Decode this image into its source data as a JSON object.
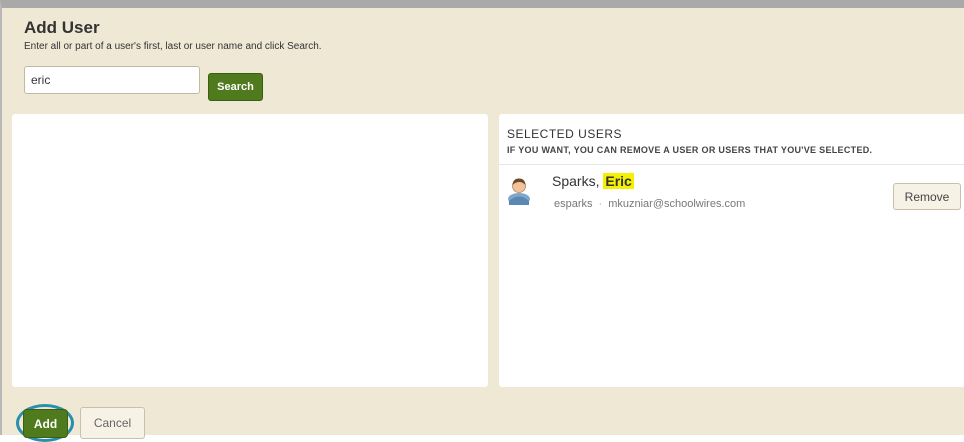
{
  "dialog": {
    "title": "Add User",
    "instructions": "Enter all or part of a user's first, last or user name and click Search."
  },
  "search": {
    "value": "eric",
    "button_label": "Search"
  },
  "selected_users": {
    "heading": "SELECTED USERS",
    "subheading": "IF YOU WANT, YOU CAN REMOVE A USER OR USERS THAT YOU'VE SELECTED.",
    "items": [
      {
        "last_name": "Sparks,",
        "first_name": "Eric",
        "username": "esparks",
        "separator": "·",
        "email": "mkuzniar@schoolwires.com",
        "remove_label": "Remove",
        "icon": "user-avatar-icon"
      }
    ]
  },
  "footer": {
    "add_label": "Add",
    "cancel_label": "Cancel"
  },
  "colors": {
    "background": "#efe8d5",
    "primary_button": "#4f7a1d",
    "highlight": "#f5f000",
    "focus_ring": "#2a8fae"
  }
}
